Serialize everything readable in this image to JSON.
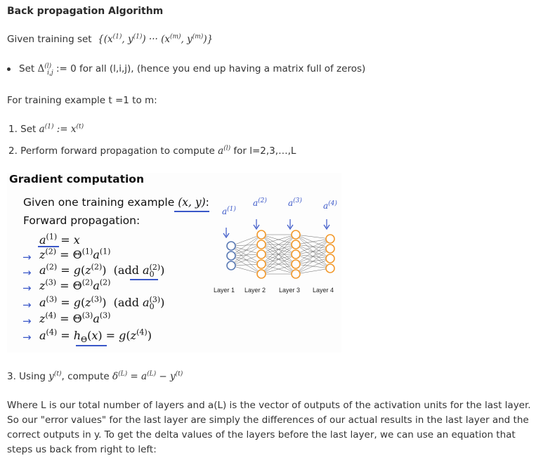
{
  "heading": "Back propagation Algorithm",
  "given_set": {
    "prefix": "Given training set"
  },
  "bullet": {
    "prefix": "Set",
    "suffix": ":= 0 for all (l,i,j), (hence you end up having a matrix full of zeros)"
  },
  "loop_text": "For training example t =1 to m:",
  "steps": [
    {
      "prefix": "1. Set",
      "suffix": ""
    },
    {
      "prefix": "2. Perform forward propagation to compute",
      "suffix": "for l=2,3,…,L"
    },
    {
      "prefix": "3. Using",
      "middle": ", compute"
    }
  ],
  "slide": {
    "title": "Gradient computation",
    "given": "Given one training example",
    "forward": "Forward propagation:",
    "layers": [
      "Layer 1",
      "Layer 2",
      "Layer 3",
      "Layer 4"
    ],
    "add_bias_label": "add",
    "colors": {
      "input": "#5b7bb5",
      "hidden": "#f29a2e",
      "ink": "#3a57c8"
    }
  },
  "paragraph": "Where L is our total number of layers and a(L) is the vector of outputs of the activation units for the last layer. So our \"error values\" for the last layer are simply the differences of our actual results in the last layer and the correct outputs in y. To get the delta values of the layers before the last layer, we can use an equation that steps us back from right to left:"
}
